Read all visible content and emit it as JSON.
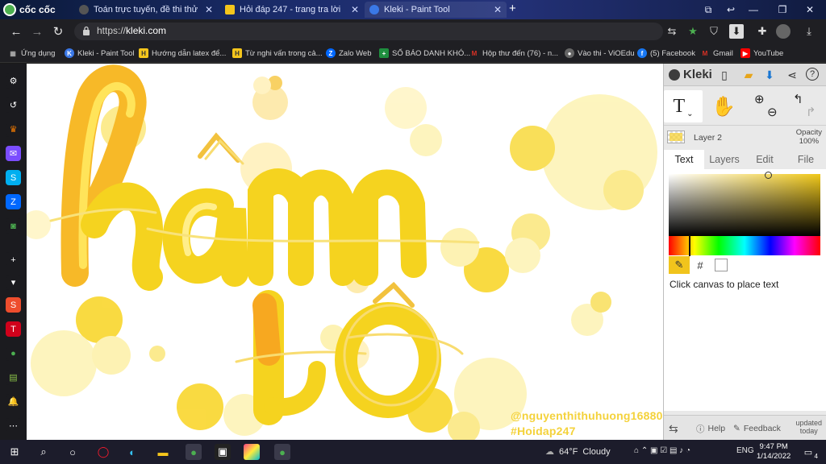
{
  "browser": {
    "brand": "cốc cốc",
    "tabs": [
      {
        "label": "Toán trực tuyến, đề thi thử",
        "icon_color": "#555555"
      },
      {
        "label": "Hỏi đáp 247 - trang tra lời",
        "icon_color": "#f4c51c"
      },
      {
        "label": "Kleki - Paint Tool",
        "icon_color": "#3a78e7",
        "active": true
      }
    ],
    "url_prefix": "https://",
    "url_host": "kleki.com"
  },
  "bookmarks": [
    {
      "label": "Ứng dụng",
      "icon": "apps-grid-icon",
      "color": "#888888",
      "glyph": "▦"
    },
    {
      "label": "Kleki - Paint Tool",
      "icon": "kleki-icon",
      "color": "#3a78e7",
      "glyph": "K"
    },
    {
      "label": "Hướng dẫn latex để...",
      "icon": "hoidap-icon",
      "color": "#f4c51c",
      "glyph": "H"
    },
    {
      "label": "Từ nghi vấn trong cả...",
      "icon": "hoidap-icon",
      "color": "#f4c51c",
      "glyph": "H"
    },
    {
      "label": "Zalo Web",
      "icon": "zalo-icon",
      "color": "#0068ff",
      "glyph": "Z"
    },
    {
      "label": "SỐ BÁO DANH KHÓ...",
      "icon": "sheets-icon",
      "color": "#1e8e3e",
      "glyph": "+"
    },
    {
      "label": "Hộp thư đến (76) - n...",
      "icon": "gmail-icon",
      "color": "#d93025",
      "glyph": "M"
    },
    {
      "label": "Vào thi - ViOEdu",
      "icon": "vioedu-icon",
      "color": "#666666",
      "glyph": "●"
    },
    {
      "label": "(5) Facebook",
      "icon": "facebook-icon",
      "color": "#1877f2",
      "glyph": "f"
    },
    {
      "label": "Gmail",
      "icon": "gmail-icon",
      "color": "#d93025",
      "glyph": "M"
    },
    {
      "label": "YouTube",
      "icon": "youtube-icon",
      "color": "#ff0000",
      "glyph": "▶"
    }
  ],
  "sidebar": [
    {
      "name": "settings-icon",
      "glyph": "⚙",
      "color": "#1b1b1f"
    },
    {
      "name": "history-icon",
      "glyph": "↺",
      "color": "#1b1b1f"
    },
    {
      "name": "crown-icon",
      "glyph": "♛",
      "color": "#1b1b1f",
      "fg": "#f57c00"
    },
    {
      "name": "messenger-icon",
      "glyph": "✉",
      "color": "#7b4dff"
    },
    {
      "name": "skype-icon",
      "glyph": "S",
      "color": "#00aff0"
    },
    {
      "name": "zalo-icon",
      "glyph": "Z",
      "color": "#0068ff"
    },
    {
      "name": "game-icon",
      "glyph": "◙",
      "color": "#1b1b1f",
      "fg": "#4caf50"
    },
    {
      "name": "add-icon",
      "glyph": "+",
      "color": "#1b1b1f"
    },
    {
      "name": "download-icon",
      "glyph": "▾",
      "color": "#1b1b1f"
    },
    {
      "name": "shopee-icon",
      "glyph": "S",
      "color": "#ee4d2d"
    },
    {
      "name": "tiki-icon",
      "glyph": "T",
      "color": "#d0011b"
    },
    {
      "name": "chat-icon",
      "glyph": "●",
      "color": "#1b1b1f",
      "fg": "#4caf50"
    },
    {
      "name": "sheet-icon",
      "glyph": "▤",
      "color": "#1b1b1f",
      "fg": "#8bc34a"
    },
    {
      "name": "bell-icon",
      "glyph": "🔔",
      "color": "#1b1b1f"
    },
    {
      "name": "more-icon",
      "glyph": "⋯",
      "color": "#1b1b1f"
    }
  ],
  "canvas": {
    "watermark_line1": "@nguyenthithuhuong16880",
    "watermark_line2": "#Hoidap247"
  },
  "kleki": {
    "logo": "Kleki",
    "layer_name": "Layer 2",
    "opacity_label": "Opacity",
    "opacity_value": "100%",
    "tabs": [
      "Text",
      "Layers",
      "Edit",
      "File"
    ],
    "active_tab": "Text",
    "hint": "Click canvas to place text",
    "color_hex_label": "#",
    "help_label": "Help",
    "feedback_label": "Feedback",
    "updated_line1": "updated",
    "updated_line2": "today",
    "accent_color": "#f1c41c"
  },
  "taskbar": {
    "weather_temp": "64°F",
    "weather_desc": "Cloudy",
    "lang": "ENG",
    "time": "9:47 PM",
    "date": "1/14/2022",
    "notification_count": "4"
  }
}
